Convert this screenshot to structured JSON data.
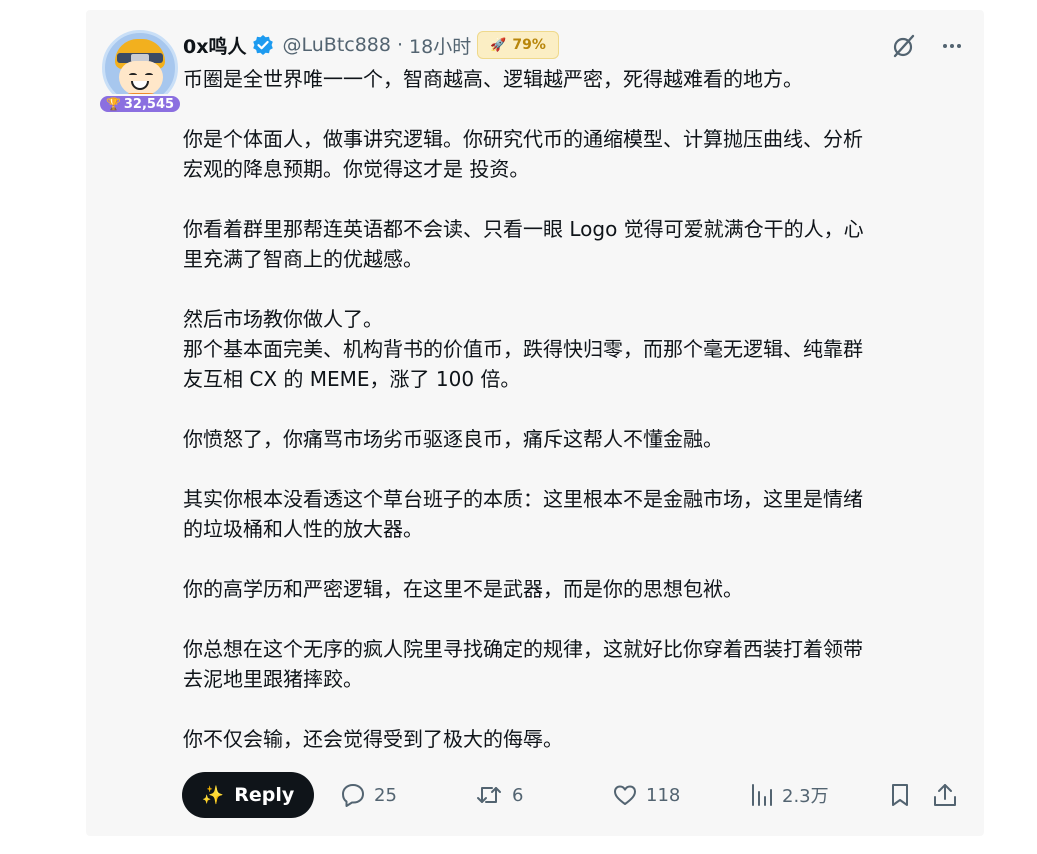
{
  "post": {
    "author_name": "0x鸣人",
    "handle": "@LuBtc888",
    "separator": "·",
    "time": "18小时",
    "rate_badge": "79%",
    "score_badge": "32,545",
    "paragraphs": [
      [
        "币圈是全世界唯一一个，智商越高、逻辑越严密，死得越难看的地方。"
      ],
      [
        "你是个体面人，做事讲究逻辑。你研究代币的通缩模型、计算抛压曲线、分析",
        "宏观的降息预期。你觉得这才是 投资。"
      ],
      [
        "你看着群里那帮连英语都不会读、只看一眼 Logo 觉得可爱就满仓干的人，心",
        "里充满了智商上的优越感。"
      ],
      [
        "然后市场教你做人了。",
        "那个基本面完美、机构背书的价值币，跌得快归零，而那个毫无逻辑、纯靠群",
        "友互相 CX 的 MEME，涨了 100 倍。"
      ],
      [
        "你愤怒了，你痛骂市场劣币驱逐良币，痛斥这帮人不懂金融。"
      ],
      [
        "其实你根本没看透这个草台班子的本质：这里根本不是金融市场，这里是情绪",
        "的垃圾桶和人性的放大器。"
      ],
      [
        "你的高学历和严密逻辑，在这里不是武器，而是你的思想包袱。"
      ],
      [
        "你总想在这个无序的疯人院里寻找确定的规律，这就好比你穿着西装打着领带",
        "去泥地里跟猪摔跤。"
      ],
      [
        "你不仅会输，还会觉得受到了极大的侮辱。"
      ]
    ]
  },
  "actions": {
    "reply_label": "Reply",
    "replies": "25",
    "reposts": "6",
    "likes": "118",
    "views": "2.3万"
  },
  "icons": [
    "verified-badge-icon",
    "rocket-icon",
    "trophy-icon",
    "grok-slash-icon",
    "more-icon",
    "sparkle-icon",
    "reply-icon",
    "repost-icon",
    "like-icon",
    "views-icon",
    "bookmark-icon",
    "share-icon"
  ],
  "colors": {
    "accent_blue": "#1d9bf0",
    "text": "#0f1419",
    "muted": "#536471",
    "badge_purple": "#8b6fe0",
    "rate_bg": "#fbeec4"
  }
}
